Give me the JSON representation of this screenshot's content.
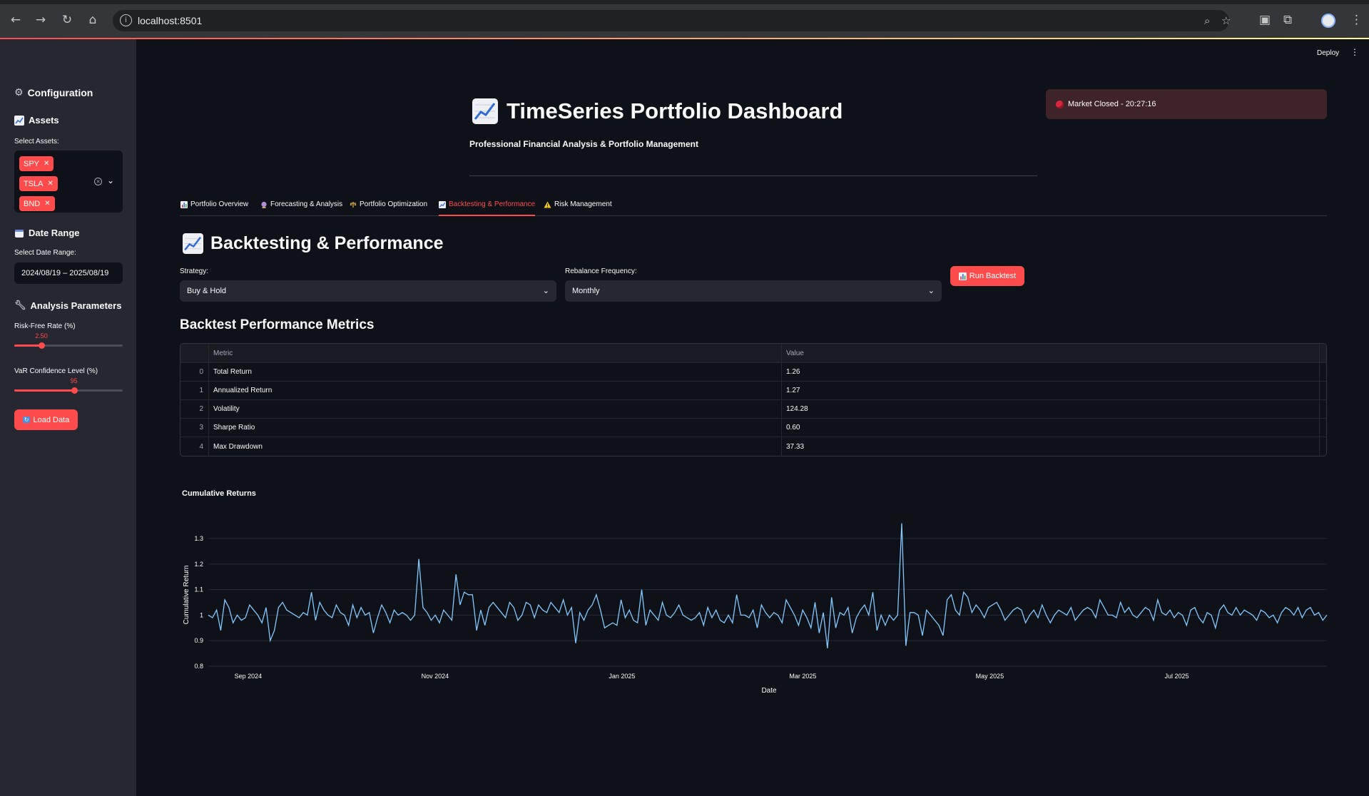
{
  "browser": {
    "url": "localhost:8501"
  },
  "header": {
    "deploy_label": "Deploy"
  },
  "sidebar": {
    "configuration_title": "Configuration",
    "assets_title": "Assets",
    "select_assets_label": "Select Assets:",
    "assets": [
      "SPY",
      "TSLA",
      "BND"
    ],
    "date_range_title": "Date Range",
    "select_date_label": "Select Date Range:",
    "date_range_value": "2024/08/19 – 2025/08/19",
    "analysis_title": "Analysis Parameters",
    "risk_free_label": "Risk-Free Rate (%)",
    "risk_free_value": "2.50",
    "risk_free_fraction": 0.25,
    "var_label": "VaR Confidence Level (%)",
    "var_value": "95",
    "var_fraction": 0.55,
    "load_button": "Load Data"
  },
  "main": {
    "title": "TimeSeries Portfolio Dashboard",
    "subtitle": "Professional Financial Analysis & Portfolio Management",
    "market_status": "Market Closed - 20:27:16",
    "tabs": [
      {
        "label": "Portfolio Overview",
        "icon": "bar-chart-icon"
      },
      {
        "label": "Forecasting & Analysis",
        "icon": "crystal-ball-icon"
      },
      {
        "label": "Portfolio Optimization",
        "icon": "scales-icon"
      },
      {
        "label": "Backtesting & Performance",
        "icon": "chart-up-icon"
      },
      {
        "label": "Risk Management",
        "icon": "warning-icon"
      }
    ],
    "active_tab": 3,
    "section_title": "Backtesting & Performance",
    "strategy_label": "Strategy:",
    "strategy_value": "Buy & Hold",
    "rebalance_label": "Rebalance Frequency:",
    "rebalance_value": "Monthly",
    "run_button": "Run Backtest",
    "metrics_title": "Backtest Performance Metrics",
    "metrics_headers": [
      "",
      "Metric",
      "Value"
    ],
    "metrics_rows": [
      [
        "0",
        "Total Return",
        "1.26"
      ],
      [
        "1",
        "Annualized Return",
        "1.27"
      ],
      [
        "2",
        "Volatility",
        "124.28"
      ],
      [
        "3",
        "Sharpe Ratio",
        "0.60"
      ],
      [
        "4",
        "Max Drawdown",
        "37.33"
      ]
    ]
  },
  "colors": {
    "accent": "#ff4b4b",
    "background": "#0e1117",
    "sidebar": "#262730",
    "line": "#83c9ff",
    "market_closed": "#3e2328"
  },
  "chart_data": {
    "type": "line",
    "title": "Cumulative Returns",
    "xlabel": "Date",
    "ylabel": "Cumulative Return",
    "x_range": [
      "2024-08-19",
      "2025-08-19"
    ],
    "ylim": [
      0.8,
      1.37
    ],
    "yticks": [
      0.8,
      0.9,
      1,
      1.1,
      1.2,
      1.3
    ],
    "xticks": [
      {
        "date": "2024-09-01",
        "label": "Sep 2024"
      },
      {
        "date": "2024-11-01",
        "label": "Nov 2024"
      },
      {
        "date": "2025-01-01",
        "label": "Jan 2025"
      },
      {
        "date": "2025-03-01",
        "label": "Mar 2025"
      },
      {
        "date": "2025-05-01",
        "label": "May 2025"
      },
      {
        "date": "2025-07-01",
        "label": "Jul 2025"
      }
    ],
    "grid": true,
    "series": [
      {
        "values": [
          1.0,
          0.99,
          1.02,
          0.94,
          1.06,
          1.03,
          0.97,
          1.0,
          0.98,
          0.99,
          1.04,
          1.02,
          1.0,
          0.97,
          1.03,
          0.9,
          0.94,
          1.03,
          1.05,
          1.02,
          1.01,
          1.0,
          0.99,
          1.01,
          1.0,
          1.09,
          0.98,
          1.05,
          1.02,
          1.0,
          0.99,
          1.04,
          1.01,
          1.0,
          0.96,
          1.04,
          0.99,
          1.03,
          1.0,
          1.01,
          0.93,
          0.99,
          1.04,
          1.01,
          0.97,
          1.02,
          1.0,
          1.01,
          1.0,
          0.98,
          1.0,
          1.22,
          1.03,
          1.01,
          0.98,
          1.0,
          0.97,
          1.02,
          1.0,
          0.98,
          1.16,
          1.04,
          1.09,
          1.08,
          1.08,
          0.94,
          1.02,
          0.96,
          1.03,
          1.05,
          1.03,
          1.01,
          0.99,
          1.05,
          1.03,
          0.98,
          1.0,
          1.05,
          1.04,
          0.99,
          1.04,
          1.02,
          1.01,
          1.05,
          1.03,
          1.01,
          1.06,
          1.0,
          1.03,
          0.89,
          1.01,
          0.98,
          1.02,
          1.04,
          1.08,
          1.02,
          0.95,
          0.96,
          0.97,
          0.96,
          1.06,
          0.99,
          1.02,
          0.98,
          0.97,
          1.1,
          0.96,
          1.02,
          1.0,
          0.98,
          1.05,
          1.0,
          0.99,
          1.01,
          1.04,
          1.0,
          0.99,
          0.98,
          0.99,
          1.01,
          0.96,
          1.03,
          0.99,
          1.02,
          0.98,
          0.97,
          1.0,
          0.97,
          1.08,
          1.0,
          1.0,
          0.99,
          1.02,
          0.95,
          1.04,
          1.01,
          0.99,
          1.01,
          1.0,
          0.97,
          1.06,
          1.03,
          1.0,
          0.96,
          1.02,
          0.99,
          0.95,
          1.05,
          0.93,
          1.01,
          0.87,
          1.07,
          0.95,
          1.01,
          1.0,
          1.03,
          0.93,
          0.99,
          1.02,
          1.04,
          1.0,
          1.09,
          0.94,
          1.0,
          0.96,
          1.0,
          0.98,
          1.0,
          1.36,
          0.88,
          1.01,
          1.01,
          1.0,
          0.92,
          1.02,
          1.0,
          0.98,
          0.96,
          0.92,
          1.06,
          1.08,
          1.02,
          1.0,
          1.09,
          1.07,
          1.01,
          1.04,
          1.02,
          0.99,
          1.03,
          1.04,
          1.05,
          1.02,
          0.98,
          1.0,
          1.02,
          1.03,
          1.02,
          0.97,
          1.0,
          1.02,
          0.99,
          1.04,
          1.0,
          0.97,
          1.0,
          1.02,
          1.01,
          1.0,
          1.03,
          0.98,
          1.0,
          1.02,
          1.03,
          1.02,
          0.99,
          1.06,
          1.03,
          1.0,
          1.0,
          0.99,
          1.05,
          1.01,
          1.03,
          1.0,
          0.99,
          1.01,
          1.03,
          1.02,
          0.98,
          1.06,
          1.01,
          1.0,
          1.02,
          0.99,
          1.01,
          1.0,
          0.96,
          1.02,
          1.03,
          0.99,
          0.97,
          1.01,
          1.0,
          0.95,
          1.02,
          1.04,
          1.01,
          1.0,
          1.03,
          1.0,
          1.02,
          1.01,
          1.0,
          0.98,
          1.02,
          1.01,
          0.99,
          1.0,
          0.97,
          1.01,
          1.03,
          1.02,
          1.0,
          1.03,
          0.99,
          1.02,
          1.03,
          1.0,
          1.01,
          0.98,
          1.0
        ]
      }
    ]
  }
}
